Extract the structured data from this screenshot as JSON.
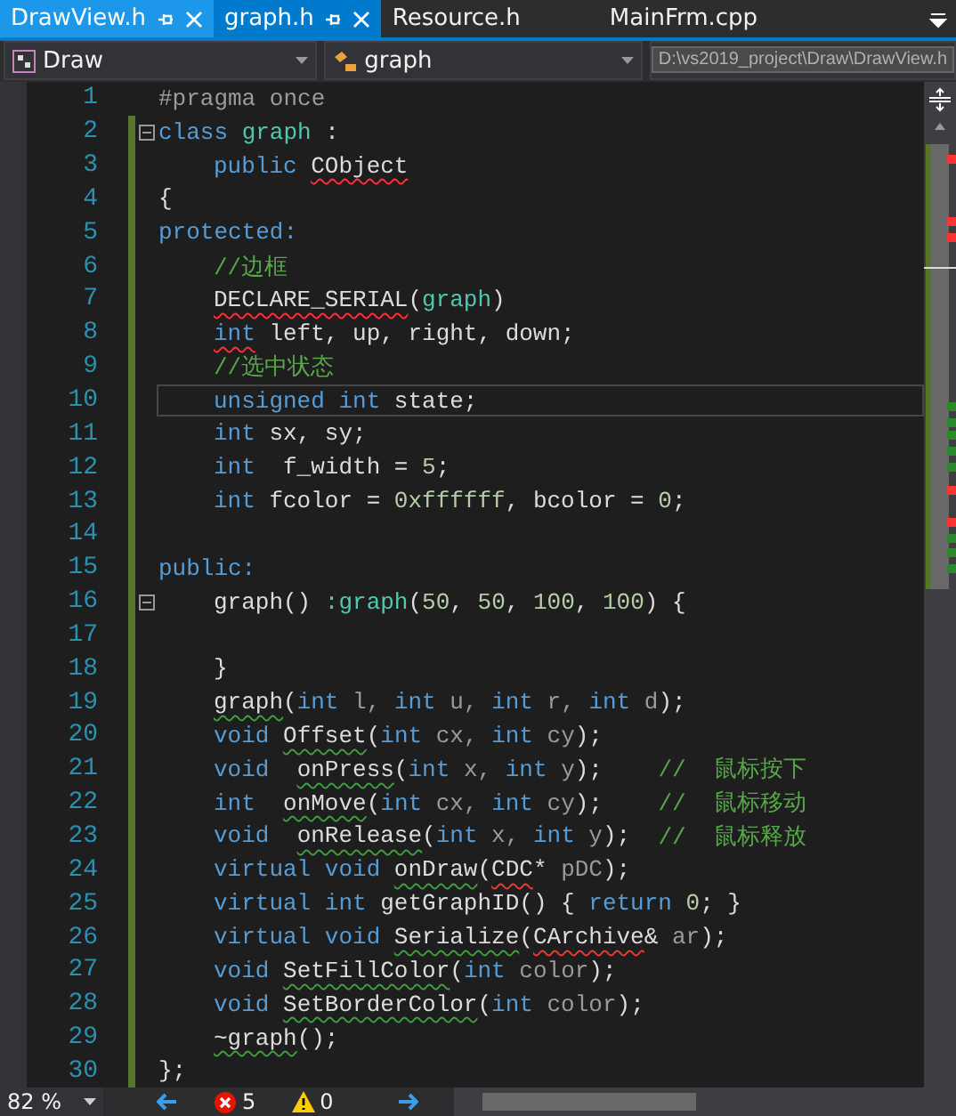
{
  "tabs": [
    {
      "label": "DrawView.h",
      "selected": false,
      "hovered": true,
      "pinned": true
    },
    {
      "label": "graph.h",
      "selected": true,
      "hovered": false,
      "pinned": true
    },
    {
      "label": "Resource.h",
      "selected": false,
      "hovered": false,
      "pinned": false
    },
    {
      "label": "MainFrm.cpp",
      "selected": false,
      "hovered": false,
      "pinned": false
    }
  ],
  "navbar": {
    "project": "Draw",
    "scope": "graph"
  },
  "tooltip": "D:\\vs2019_project\\Draw\\DrawView.h",
  "lines": [
    {
      "number": "1",
      "changed": false,
      "fold": false,
      "current": false,
      "indented": false,
      "tokens": [
        {
          "text": "#pragma once",
          "kind": "pre"
        }
      ]
    },
    {
      "number": "2",
      "changed": true,
      "fold": true,
      "current": false,
      "indented": false,
      "tokens": [
        {
          "text": "class ",
          "kind": "kw"
        },
        {
          "text": "graph",
          "kind": "cls"
        },
        {
          "text": " :",
          "kind": "text"
        }
      ]
    },
    {
      "number": "3",
      "changed": true,
      "fold": false,
      "current": false,
      "indented": true,
      "tokens": [
        {
          "text": "public ",
          "kind": "kw"
        },
        {
          "text": "CObject",
          "kind": "text",
          "error": true
        }
      ]
    },
    {
      "number": "4",
      "changed": true,
      "fold": false,
      "current": false,
      "indented": false,
      "tokens": [
        {
          "text": "{",
          "kind": "text"
        }
      ]
    },
    {
      "number": "5",
      "changed": true,
      "fold": false,
      "current": false,
      "indented": false,
      "tokens": [
        {
          "text": "protected:",
          "kind": "kw"
        }
      ]
    },
    {
      "number": "6",
      "changed": true,
      "fold": false,
      "current": false,
      "indented": true,
      "tokens": [
        {
          "text": "//边框",
          "kind": "comment"
        }
      ]
    },
    {
      "number": "7",
      "changed": true,
      "fold": false,
      "current": false,
      "indented": true,
      "tokens": [
        {
          "text": "DECLARE_SERIAL",
          "kind": "text",
          "error": true
        },
        {
          "text": "(",
          "kind": "text"
        },
        {
          "text": "graph",
          "kind": "cls"
        },
        {
          "text": ")",
          "kind": "text"
        }
      ]
    },
    {
      "number": "8",
      "changed": true,
      "fold": false,
      "current": false,
      "indented": true,
      "tokens": [
        {
          "text": "int",
          "kind": "kw",
          "error": true
        },
        {
          "text": " left, up, right, down;",
          "kind": "text"
        }
      ]
    },
    {
      "number": "9",
      "changed": true,
      "fold": false,
      "current": false,
      "indented": true,
      "tokens": [
        {
          "text": "//选中状态",
          "kind": "comment"
        }
      ]
    },
    {
      "number": "10",
      "changed": true,
      "fold": false,
      "current": true,
      "indented": true,
      "tokens": [
        {
          "text": "unsigned int",
          "kind": "kw"
        },
        {
          "text": " state;",
          "kind": "text"
        }
      ]
    },
    {
      "number": "11",
      "changed": true,
      "fold": false,
      "current": false,
      "indented": true,
      "tokens": [
        {
          "text": "int",
          "kind": "kw"
        },
        {
          "text": " sx, sy;",
          "kind": "text"
        }
      ]
    },
    {
      "number": "12",
      "changed": true,
      "fold": false,
      "current": false,
      "indented": true,
      "tokens": [
        {
          "text": "int",
          "kind": "kw"
        },
        {
          "text": "  f_width = ",
          "kind": "text"
        },
        {
          "text": "5",
          "kind": "num"
        },
        {
          "text": ";",
          "kind": "text"
        }
      ]
    },
    {
      "number": "13",
      "changed": true,
      "fold": false,
      "current": false,
      "indented": true,
      "tokens": [
        {
          "text": "int",
          "kind": "kw"
        },
        {
          "text": " fcolor = ",
          "kind": "text"
        },
        {
          "text": "0xffffff",
          "kind": "num"
        },
        {
          "text": ", bcolor = ",
          "kind": "text"
        },
        {
          "text": "0",
          "kind": "num"
        },
        {
          "text": ";",
          "kind": "text"
        }
      ]
    },
    {
      "number": "14",
      "changed": true,
      "fold": false,
      "current": false,
      "indented": false
    },
    {
      "number": "15",
      "changed": true,
      "fold": false,
      "current": false,
      "indented": false,
      "tokens": [
        {
          "text": "public:",
          "kind": "kw"
        }
      ]
    },
    {
      "number": "16",
      "changed": true,
      "fold": true,
      "current": false,
      "indented": true,
      "tokens": [
        {
          "text": "graph() ",
          "kind": "text"
        },
        {
          "text": ":graph",
          "kind": "cls"
        },
        {
          "text": "(",
          "kind": "text"
        },
        {
          "text": "50",
          "kind": "num"
        },
        {
          "text": ", ",
          "kind": "text"
        },
        {
          "text": "50",
          "kind": "num"
        },
        {
          "text": ", ",
          "kind": "text"
        },
        {
          "text": "100",
          "kind": "num"
        },
        {
          "text": ", ",
          "kind": "text"
        },
        {
          "text": "100",
          "kind": "num"
        },
        {
          "text": ") {",
          "kind": "text"
        }
      ]
    },
    {
      "number": "17",
      "changed": true,
      "fold": false,
      "current": false,
      "indented": false
    },
    {
      "number": "18",
      "changed": true,
      "fold": false,
      "current": false,
      "indented": true,
      "tokens": [
        {
          "text": "}",
          "kind": "text"
        }
      ]
    },
    {
      "number": "19",
      "changed": true,
      "fold": false,
      "current": false,
      "indented": true,
      "tokens": [
        {
          "text": "graph",
          "kind": "text",
          "warning": true
        },
        {
          "text": "(",
          "kind": "text"
        },
        {
          "text": "int",
          "kind": "kw"
        },
        {
          "text": " l, ",
          "kind": "param"
        },
        {
          "text": "int",
          "kind": "kw"
        },
        {
          "text": " u, ",
          "kind": "param"
        },
        {
          "text": "int",
          "kind": "kw"
        },
        {
          "text": " r, ",
          "kind": "param"
        },
        {
          "text": "int",
          "kind": "kw"
        },
        {
          "text": " d",
          "kind": "param"
        },
        {
          "text": ");",
          "kind": "text"
        }
      ]
    },
    {
      "number": "20",
      "changed": true,
      "fold": false,
      "current": false,
      "indented": true,
      "tokens": [
        {
          "text": "void ",
          "kind": "kw"
        },
        {
          "text": "Offset",
          "kind": "text",
          "warning": true
        },
        {
          "text": "(",
          "kind": "text"
        },
        {
          "text": "int",
          "kind": "kw"
        },
        {
          "text": " cx, ",
          "kind": "param"
        },
        {
          "text": "int",
          "kind": "kw"
        },
        {
          "text": " cy",
          "kind": "param"
        },
        {
          "text": ");",
          "kind": "text"
        }
      ]
    },
    {
      "number": "21",
      "changed": true,
      "fold": false,
      "current": false,
      "indented": true,
      "tokens": [
        {
          "text": "void  ",
          "kind": "kw"
        },
        {
          "text": "onPress",
          "kind": "text",
          "warning": true
        },
        {
          "text": "(",
          "kind": "text"
        },
        {
          "text": "int",
          "kind": "kw"
        },
        {
          "text": " x, ",
          "kind": "param"
        },
        {
          "text": "int",
          "kind": "kw"
        },
        {
          "text": " y",
          "kind": "param"
        },
        {
          "text": ");    ",
          "kind": "text"
        },
        {
          "text": "//  鼠标按下",
          "kind": "comment"
        }
      ]
    },
    {
      "number": "22",
      "changed": true,
      "fold": false,
      "current": false,
      "indented": true,
      "tokens": [
        {
          "text": "int  ",
          "kind": "kw"
        },
        {
          "text": "onMove",
          "kind": "text",
          "warning": true
        },
        {
          "text": "(",
          "kind": "text"
        },
        {
          "text": "int",
          "kind": "kw"
        },
        {
          "text": " cx, ",
          "kind": "param"
        },
        {
          "text": "int",
          "kind": "kw"
        },
        {
          "text": " cy",
          "kind": "param"
        },
        {
          "text": ");    ",
          "kind": "text"
        },
        {
          "text": "//  鼠标移动",
          "kind": "comment"
        }
      ]
    },
    {
      "number": "23",
      "changed": true,
      "fold": false,
      "current": false,
      "indented": true,
      "tokens": [
        {
          "text": "void  ",
          "kind": "kw"
        },
        {
          "text": "onRelease",
          "kind": "text",
          "warning": true
        },
        {
          "text": "(",
          "kind": "text"
        },
        {
          "text": "int",
          "kind": "kw"
        },
        {
          "text": " x, ",
          "kind": "param"
        },
        {
          "text": "int",
          "kind": "kw"
        },
        {
          "text": " y",
          "kind": "param"
        },
        {
          "text": ");  ",
          "kind": "text"
        },
        {
          "text": "//  鼠标释放",
          "kind": "comment"
        }
      ]
    },
    {
      "number": "24",
      "changed": true,
      "fold": false,
      "current": false,
      "indented": true,
      "tokens": [
        {
          "text": "virtual void ",
          "kind": "kw"
        },
        {
          "text": "onDraw",
          "kind": "text",
          "warning": true
        },
        {
          "text": "(",
          "kind": "text"
        },
        {
          "text": "CDC",
          "kind": "text",
          "error": true
        },
        {
          "text": "*",
          "kind": "text"
        },
        {
          "text": " pDC",
          "kind": "param"
        },
        {
          "text": ");",
          "kind": "text"
        }
      ]
    },
    {
      "number": "25",
      "changed": true,
      "fold": false,
      "current": false,
      "indented": true,
      "tokens": [
        {
          "text": "virtual int",
          "kind": "kw"
        },
        {
          "text": " getGraphID() { ",
          "kind": "text"
        },
        {
          "text": "return ",
          "kind": "kw"
        },
        {
          "text": "0",
          "kind": "num"
        },
        {
          "text": "; }",
          "kind": "text"
        }
      ]
    },
    {
      "number": "26",
      "changed": true,
      "fold": false,
      "current": false,
      "indented": true,
      "tokens": [
        {
          "text": "virtual void ",
          "kind": "kw"
        },
        {
          "text": "Serialize",
          "kind": "text",
          "warning": true
        },
        {
          "text": "(",
          "kind": "text"
        },
        {
          "text": "CArchive",
          "kind": "text",
          "error": true
        },
        {
          "text": "&",
          "kind": "text"
        },
        {
          "text": " ar",
          "kind": "param"
        },
        {
          "text": ");",
          "kind": "text"
        }
      ]
    },
    {
      "number": "27",
      "changed": true,
      "fold": false,
      "current": false,
      "indented": true,
      "tokens": [
        {
          "text": "void ",
          "kind": "kw"
        },
        {
          "text": "SetFillColor",
          "kind": "text",
          "warning": true
        },
        {
          "text": "(",
          "kind": "text"
        },
        {
          "text": "int",
          "kind": "kw"
        },
        {
          "text": " color",
          "kind": "param"
        },
        {
          "text": ");",
          "kind": "text"
        }
      ]
    },
    {
      "number": "28",
      "changed": true,
      "fold": false,
      "current": false,
      "indented": true,
      "tokens": [
        {
          "text": "void ",
          "kind": "kw"
        },
        {
          "text": "SetBorderColor",
          "kind": "text",
          "warning": true
        },
        {
          "text": "(",
          "kind": "text"
        },
        {
          "text": "int",
          "kind": "kw"
        },
        {
          "text": " color",
          "kind": "param"
        },
        {
          "text": ");",
          "kind": "text"
        }
      ]
    },
    {
      "number": "29",
      "changed": true,
      "fold": false,
      "current": false,
      "indented": true,
      "tokens": [
        {
          "text": "~graph",
          "kind": "text",
          "warning": true
        },
        {
          "text": "();",
          "kind": "text"
        }
      ]
    },
    {
      "number": "30",
      "changed": true,
      "fold": false,
      "current": false,
      "indented": false,
      "tokens": [
        {
          "text": "};",
          "kind": "text"
        }
      ]
    }
  ],
  "status_bar": {
    "zoom": "82 %",
    "errors": "5",
    "warnings": "0"
  }
}
